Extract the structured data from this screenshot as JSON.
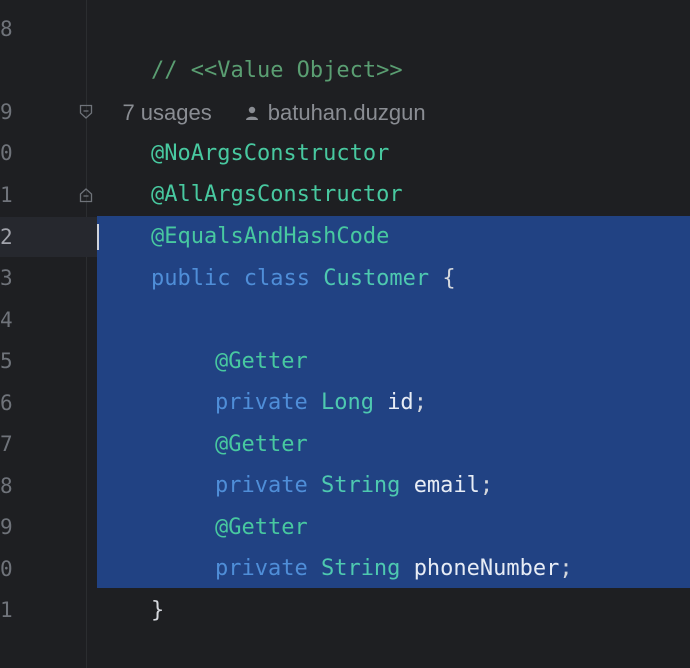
{
  "gutter": {
    "line_numbers": [
      "8",
      "9",
      "0",
      "1",
      "2",
      "3",
      "4",
      "5",
      "6",
      "7",
      "8",
      "9",
      "0",
      "1"
    ]
  },
  "inlay_hint": {
    "usages": "7 usages",
    "author": "batuhan.duzgun"
  },
  "code": {
    "comment": "// <<Value Object>>",
    "annotation_1": "@NoArgsConstructor",
    "annotation_2": "@AllArgsConstructor",
    "annotation_3": "@EqualsAndHashCode",
    "kw_public": "public",
    "kw_class": "class",
    "class_name": "Customer",
    "open_brace": " {",
    "getter": "@Getter",
    "kw_private": "private",
    "type_long": "Long",
    "type_string": "String",
    "field_id": "id",
    "field_email": "email",
    "field_phone": "phoneNumber",
    "semicolon": ";",
    "close_brace": "}"
  },
  "colors": {
    "background": "#1e1f22",
    "selection": "#214283",
    "annotation": "#48c9a0",
    "keyword": "#4f8ed8",
    "type": "#4ec9b0",
    "comment": "#5a9e72"
  },
  "icons": {
    "author": "user-icon",
    "fold": "fold-marker-icon"
  }
}
